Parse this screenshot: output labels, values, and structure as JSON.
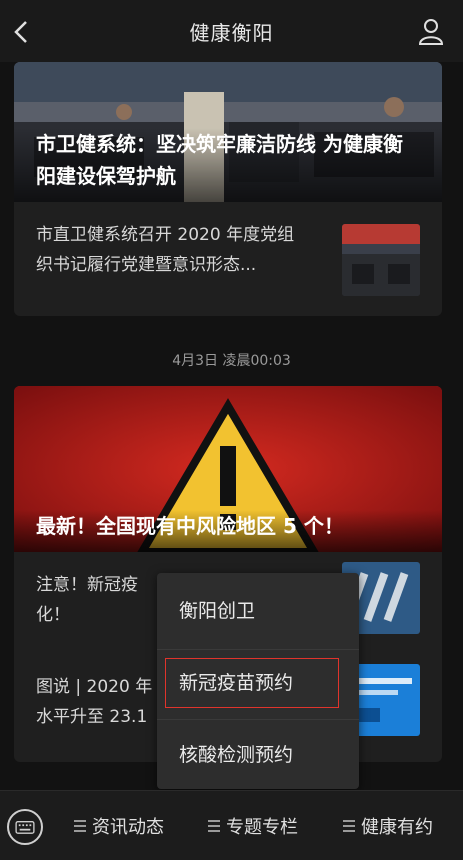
{
  "header": {
    "title": "健康衡阳"
  },
  "cards": [
    {
      "headline": "市卫健系统：坚决筑牢廉洁防线 为健康衡阳建设保驾护航",
      "sub_text": "市直卫健系统召开 2020 年度党组织书记履行党建暨意识形态..."
    },
    {
      "headline": "最新！全国现有中风险地区 5 个！",
      "sub1_text": "注意！新冠疫",
      "sub1_text2": "化！",
      "sub2_text": "图说 | 2020 年",
      "sub2_text2": "水平升至 23.1"
    }
  ],
  "timestamp": "4月3日 凌晨00:03",
  "popup_menu": {
    "items": [
      {
        "label": "衡阳创卫"
      },
      {
        "label": "新冠疫苗预约",
        "selected": true
      },
      {
        "label": "核酸检测预约"
      }
    ]
  },
  "bottom_nav": {
    "tabs": [
      {
        "label": "资讯动态"
      },
      {
        "label": "专题专栏"
      },
      {
        "label": "健康有约"
      }
    ]
  },
  "colors": {
    "selection_border": "#e0342c",
    "background": "#121212"
  }
}
